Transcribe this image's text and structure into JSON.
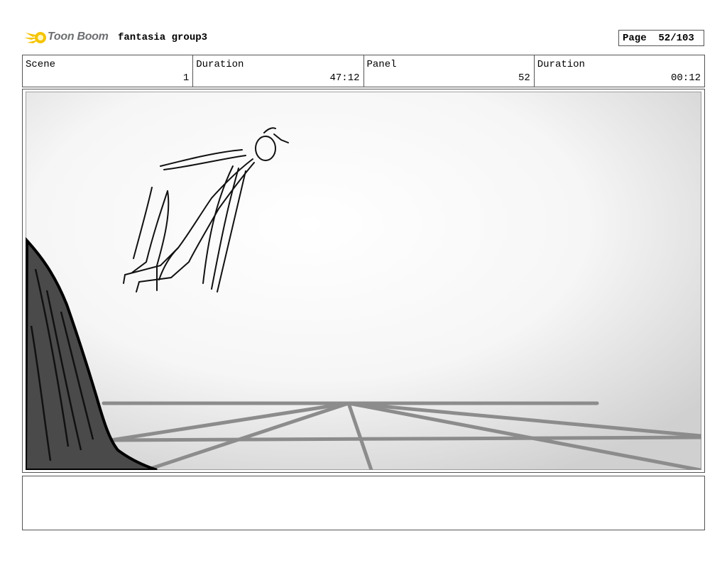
{
  "header": {
    "brand_name": "Toon Boom",
    "brand_color": "#f5c400",
    "project_title": "fantasia group3",
    "page_indicator": "Page  52/103"
  },
  "info": [
    {
      "label": "Scene",
      "value": "1"
    },
    {
      "label": "Duration",
      "value": "47:12"
    },
    {
      "label": "Panel",
      "value": "52"
    },
    {
      "label": "Duration",
      "value": "00:12"
    }
  ],
  "panel": {
    "content": "storyboard-sketch",
    "colors": {
      "cliff": "#4a4a4a",
      "grid": "#8c8c8c",
      "background": "#f2f2f2"
    }
  },
  "notes": {
    "text": ""
  }
}
